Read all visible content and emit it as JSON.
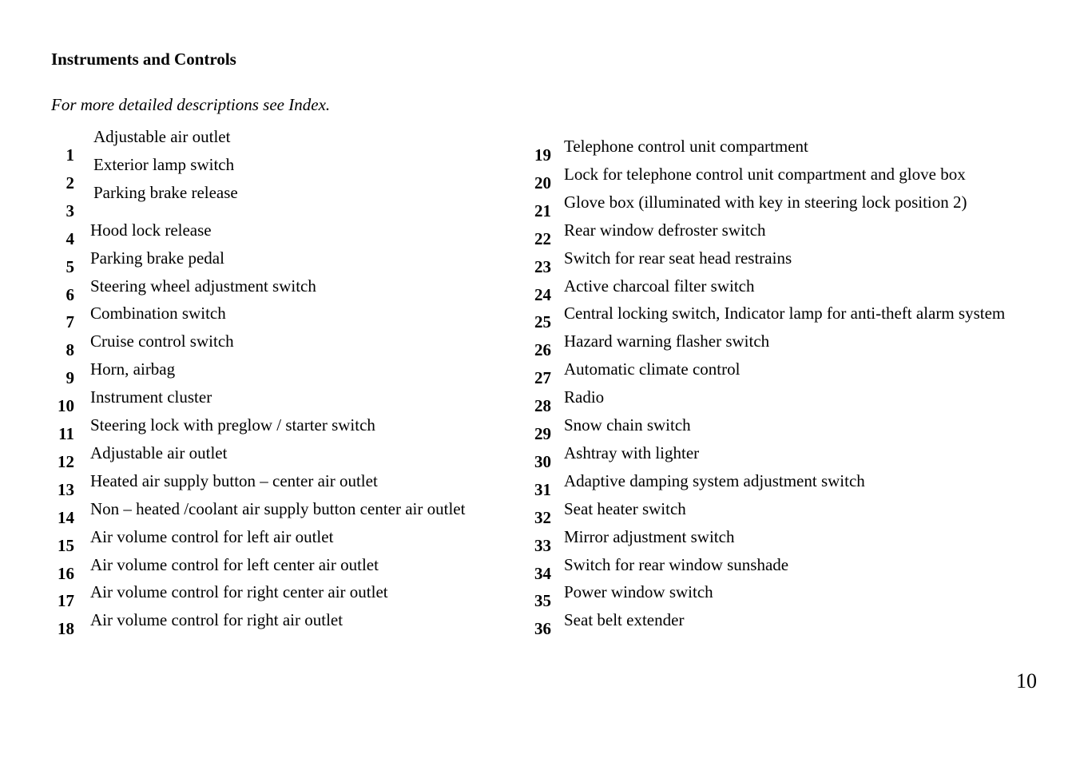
{
  "header": {
    "title": "Instruments and Controls",
    "subtitle": "For more detailed descriptions see Index."
  },
  "left_column": [
    {
      "number": "1",
      "label": "Adjustable air outlet"
    },
    {
      "number": "2",
      "label": "Exterior lamp switch"
    },
    {
      "number": "3",
      "label": "Parking brake release"
    },
    {
      "number": "4",
      "label": "Hood lock release"
    },
    {
      "number": "5",
      "label": "Parking brake pedal"
    },
    {
      "number": "6",
      "label": "Steering wheel adjustment switch"
    },
    {
      "number": "7",
      "label": "Combination switch"
    },
    {
      "number": "8",
      "label": "Cruise control switch"
    },
    {
      "number": "9",
      "label": "Horn, airbag"
    },
    {
      "number": "10",
      "label": "Instrument cluster"
    },
    {
      "number": "11",
      "label": "Steering lock with preglow / starter switch"
    },
    {
      "number": "12",
      "label": "Adjustable air outlet"
    },
    {
      "number": "13",
      "label": "Heated air supply button – center air outlet"
    },
    {
      "number": "14",
      "label": "Non – heated /coolant air supply button center air outlet"
    },
    {
      "number": "15",
      "label": "Air volume control for left air outlet"
    },
    {
      "number": "16",
      "label": "Air volume control for left center air outlet"
    },
    {
      "number": "17",
      "label": "Air volume control for right center air outlet"
    },
    {
      "number": "18",
      "label": "Air volume control for right air outlet"
    }
  ],
  "right_column": [
    {
      "number": "19",
      "label": "Telephone control unit compartment"
    },
    {
      "number": "20",
      "label": "Lock for telephone control unit compartment and glove box"
    },
    {
      "number": "21",
      "label": "Glove box (illuminated with key in steering lock position 2)"
    },
    {
      "number": "22",
      "label": "Rear window defroster switch"
    },
    {
      "number": "23",
      "label": "Switch for rear seat head restrains"
    },
    {
      "number": "24",
      "label": "Active charcoal filter switch"
    },
    {
      "number": "25",
      "label": "Central locking switch, Indicator lamp for anti-theft alarm system"
    },
    {
      "number": "26",
      "label": "Hazard warning flasher switch"
    },
    {
      "number": "27",
      "label": "Automatic climate control"
    },
    {
      "number": "28",
      "label": "Radio"
    },
    {
      "number": "29",
      "label": "Snow chain switch"
    },
    {
      "number": "30",
      "label": "Ashtray with lighter"
    },
    {
      "number": "31",
      "label": "Adaptive damping system adjustment switch"
    },
    {
      "number": "32",
      "label": "Seat heater switch"
    },
    {
      "number": "33",
      "label": "Mirror adjustment switch"
    },
    {
      "number": "34",
      "label": "Switch for rear window sunshade"
    },
    {
      "number": "35",
      "label": "Power window switch"
    },
    {
      "number": "36",
      "label": "Seat belt extender"
    }
  ],
  "footer": {
    "page_number": "10"
  }
}
